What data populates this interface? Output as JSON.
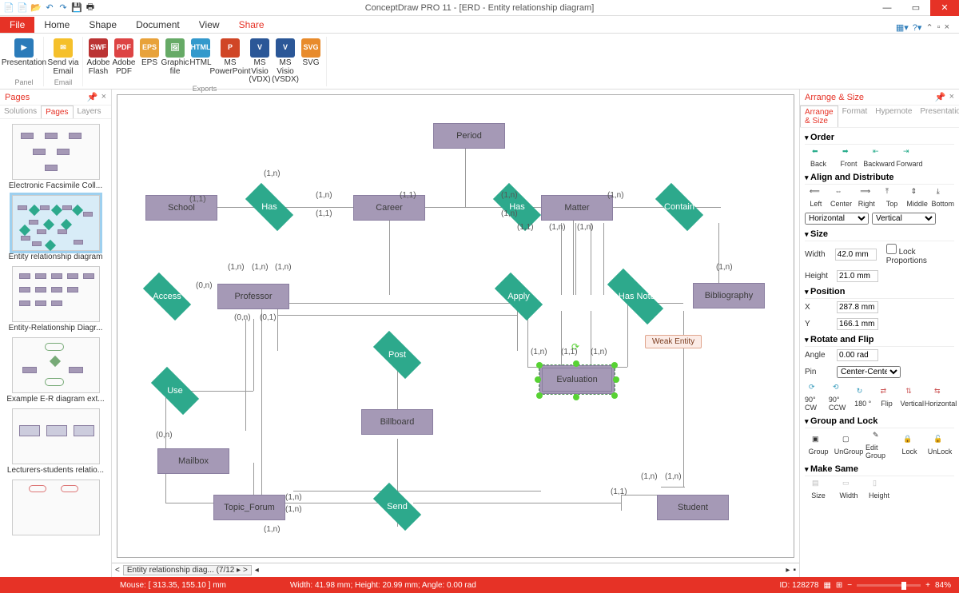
{
  "app_title": "ConceptDraw PRO 11 - [ERD - Entity relationship diagram]",
  "tabs": {
    "file": "File",
    "home": "Home",
    "shape": "Shape",
    "document": "Document",
    "view": "View",
    "share": "Share"
  },
  "ribbon": {
    "presentation": "Presentation",
    "sendemail": "Send via Email",
    "flash": "Adobe Flash",
    "pdf": "Adobe PDF",
    "eps": "EPS",
    "graphic": "Graphic file",
    "html": "HTML",
    "ppt": "MS PowerPoint",
    "vdx": "MS Visio (VDX)",
    "vsdx": "MS Visio (VSDX)",
    "svg": "SVG",
    "panel_label": "Panel",
    "email_label": "Email",
    "exports_label": "Exports"
  },
  "pages_panel": {
    "title": "Pages",
    "subtabs": {
      "solutions": "Solutions",
      "pages": "Pages",
      "layers": "Layers"
    },
    "thumbs": [
      {
        "caption": "Electronic Facsimile Coll..."
      },
      {
        "caption": "Entity relationship diagram"
      },
      {
        "caption": "Entity-Relationship Diagr..."
      },
      {
        "caption": "Example E-R diagram ext..."
      },
      {
        "caption": "Lecturers-students relatio..."
      }
    ]
  },
  "entities": {
    "school": "School",
    "career": "Career",
    "period": "Period",
    "matter": "Matter",
    "professor": "Professor",
    "billboard": "Billboard",
    "mailbox": "Mailbox",
    "topic": "Topic_Forum",
    "student": "Student",
    "bibliography": "Bibliography",
    "evaluation": "Evaluation"
  },
  "relations": {
    "has1": "Has",
    "has2": "Has",
    "contain": "Contain",
    "access": "Access",
    "apply": "Apply",
    "notes": "It Has Notes",
    "use": "Use",
    "post": "Post",
    "send": "Send"
  },
  "cards": {
    "c11": "(1,1)",
    "c1n": "(1,n)",
    "c0n": "(0,n)",
    "c01": "(0,1)"
  },
  "tooltip": "Weak Entity",
  "tabstrip": {
    "current": "Entity relationship diag...",
    "count": "(7/12"
  },
  "right": {
    "title": "Arrange & Size",
    "subtabs": {
      "as": "Arrange & Size",
      "format": "Format",
      "hyper": "Hypernote",
      "pres": "Presentation"
    },
    "order": {
      "head": "Order",
      "back": "Back",
      "front": "Front",
      "backward": "Backward",
      "forward": "Forward"
    },
    "align": {
      "head": "Align and Distribute",
      "left": "Left",
      "center": "Center",
      "right": "Right",
      "top": "Top",
      "middle": "Middle",
      "bottom": "Bottom",
      "horiz": "Horizontal",
      "vert": "Vertical"
    },
    "size": {
      "head": "Size",
      "width_l": "Width",
      "width_v": "42.0 mm",
      "height_l": "Height",
      "height_v": "21.0 mm",
      "lock": "Lock Proportions"
    },
    "pos": {
      "head": "Position",
      "x": "X",
      "xv": "287.8 mm",
      "y": "Y",
      "yv": "166.1 mm"
    },
    "rot": {
      "head": "Rotate and Flip",
      "angle_l": "Angle",
      "angle_v": "0.00 rad",
      "pin_l": "Pin",
      "pin_v": "Center-Center",
      "cw": "90° CW",
      "ccw": "90° CCW",
      "d180": "180 °",
      "flip": "Flip",
      "vert": "Vertical",
      "horiz": "Horizontal"
    },
    "group": {
      "head": "Group and Lock",
      "group": "Group",
      "ungroup": "UnGroup",
      "edit": "Edit Group",
      "lock": "Lock",
      "unlock": "UnLock"
    },
    "same": {
      "head": "Make Same",
      "size": "Size",
      "width": "Width",
      "height": "Height"
    }
  },
  "status": {
    "mouse": "Mouse: [ 313.35, 155.10 ] mm",
    "dims": "Width: 41.98 mm;  Height: 20.99 mm;  Angle: 0.00 rad",
    "id": "ID: 128278",
    "zoom": "84%"
  },
  "chart_data": {
    "type": "diagram",
    "diagram_type": "entity-relationship",
    "entities": [
      "School",
      "Career",
      "Period",
      "Matter",
      "Professor",
      "Billboard",
      "Mailbox",
      "Topic_Forum",
      "Student",
      "Bibliography",
      "Evaluation"
    ],
    "weak_entities": [
      "Evaluation"
    ],
    "relationships": [
      {
        "name": "Has",
        "between": [
          "School",
          "Career"
        ],
        "card": [
          "(1,1)",
          "(1,n)"
        ]
      },
      {
        "name": "Has",
        "between": [
          "Career",
          "Matter"
        ],
        "card": [
          "(1,1)",
          "(1,n)"
        ]
      },
      {
        "name": "Has",
        "between": [
          "Career",
          "Professor"
        ],
        "card": [
          "(1,n)",
          "(1,1)"
        ]
      },
      {
        "name": "Has",
        "between": [
          "Period",
          "Has"
        ],
        "card": [
          "(1,n)",
          "(1,n)"
        ]
      },
      {
        "name": "Contain",
        "between": [
          "Matter",
          "Bibliography"
        ],
        "card": [
          "(1,n)",
          "(1,n)"
        ]
      },
      {
        "name": "Access",
        "between": [
          "Professor"
        ],
        "card": [
          "(0,n)"
        ]
      },
      {
        "name": "Apply",
        "between": [
          "Professor",
          "Matter",
          "Evaluation"
        ],
        "card": [
          "(1,n)",
          "(1,n)",
          "(1,n)"
        ]
      },
      {
        "name": "It Has Notes",
        "between": [
          "Matter",
          "Evaluation",
          "Student"
        ],
        "card": [
          "(1,n)",
          "(1,n)",
          "(1,n)"
        ]
      },
      {
        "name": "Use",
        "between": [
          "Professor",
          "Mailbox"
        ],
        "card": [
          "(0,n)",
          "(0,n)"
        ]
      },
      {
        "name": "Post",
        "between": [
          "Professor",
          "Billboard"
        ],
        "card": [
          "(0,n)",
          "(0,1)"
        ]
      },
      {
        "name": "Send",
        "between": [
          "Topic_Forum",
          "Student"
        ],
        "card": [
          "(1,n)",
          "(1,n)",
          "(1,1)"
        ]
      }
    ]
  }
}
